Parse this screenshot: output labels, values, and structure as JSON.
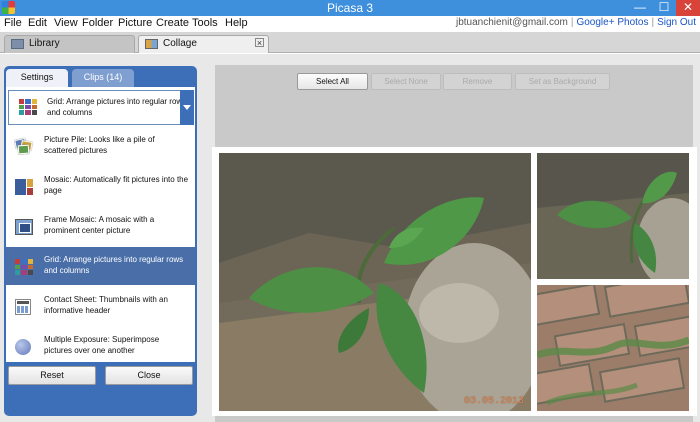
{
  "window": {
    "title": "Picasa 3",
    "controls": {
      "minimize": "—",
      "maximize": "☐",
      "close": "✕"
    }
  },
  "menu": {
    "items": [
      "File",
      "Edit",
      "View",
      "Folder",
      "Picture",
      "Create",
      "Tools",
      "Help"
    ],
    "account": "jbtuanchienit@gmail.com",
    "links": [
      "Google+ Photos",
      "Sign Out"
    ]
  },
  "tabs": [
    {
      "label": "Library",
      "icon": "library-icon"
    },
    {
      "label": "Collage",
      "icon": "collage-icon",
      "active": true
    }
  ],
  "panel": {
    "tabs": [
      "Settings",
      "Clips (14)"
    ],
    "active_tab": "Settings",
    "selected": "Grid:  Arrange pictures into regular rows and columns",
    "options": [
      {
        "label": "Picture Pile:  Looks like a pile of scattered pictures",
        "icon": "picture-pile-icon"
      },
      {
        "label": "Mosaic:  Automatically fit pictures into the page",
        "icon": "mosaic-icon"
      },
      {
        "label": "Frame Mosaic: A mosaic with a prominent center picture",
        "icon": "frame-mosaic-icon"
      },
      {
        "label": "Grid:  Arrange pictures into regular rows and columns",
        "icon": "grid-icon",
        "active": true
      },
      {
        "label": "Contact Sheet:  Thumbnails with an informative header",
        "icon": "contact-sheet-icon"
      },
      {
        "label": "Multiple Exposure:  Superimpose pictures over one another",
        "icon": "multiple-exposure-icon"
      }
    ],
    "buttons": {
      "reset": "Reset",
      "close": "Close"
    }
  },
  "toolbar": {
    "select_all": "Select All",
    "select_none": "Select None",
    "remove": "Remove",
    "set_background": "Set as Background"
  },
  "collage": {
    "date_stamp": "03.05.2013"
  },
  "colors": {
    "titlebar": "#3e8fdc",
    "panel": "#3d6fb8",
    "active_option": "#4a6ea8",
    "close_button": "#d9443a"
  }
}
